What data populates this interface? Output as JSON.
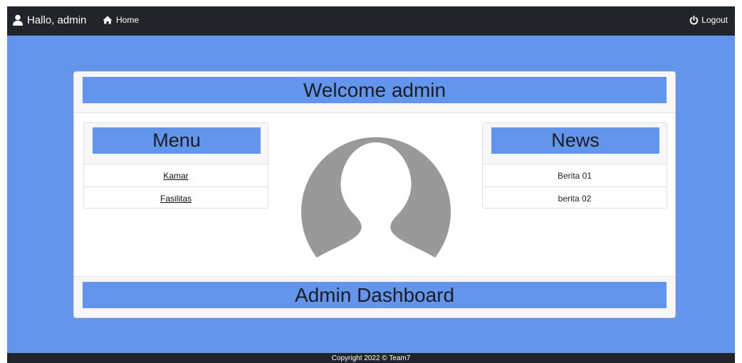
{
  "navbar": {
    "greeting": "Hallo, admin",
    "home_label": "Home",
    "logout_label": "Logout"
  },
  "card": {
    "header_title": "Welcome admin",
    "footer_title": "Admin Dashboard"
  },
  "menu": {
    "title": "Menu",
    "items": [
      {
        "label": "Kamar"
      },
      {
        "label": "Fasilitas"
      }
    ]
  },
  "news": {
    "title": "News",
    "items": [
      {
        "label": "Berita 01"
      },
      {
        "label": "berita 02"
      }
    ]
  },
  "footer": {
    "copyright": "Copyright 2022 © Team7"
  },
  "colors": {
    "accent": "#6495ed",
    "navbar": "#212529",
    "avatar": "#999999"
  }
}
